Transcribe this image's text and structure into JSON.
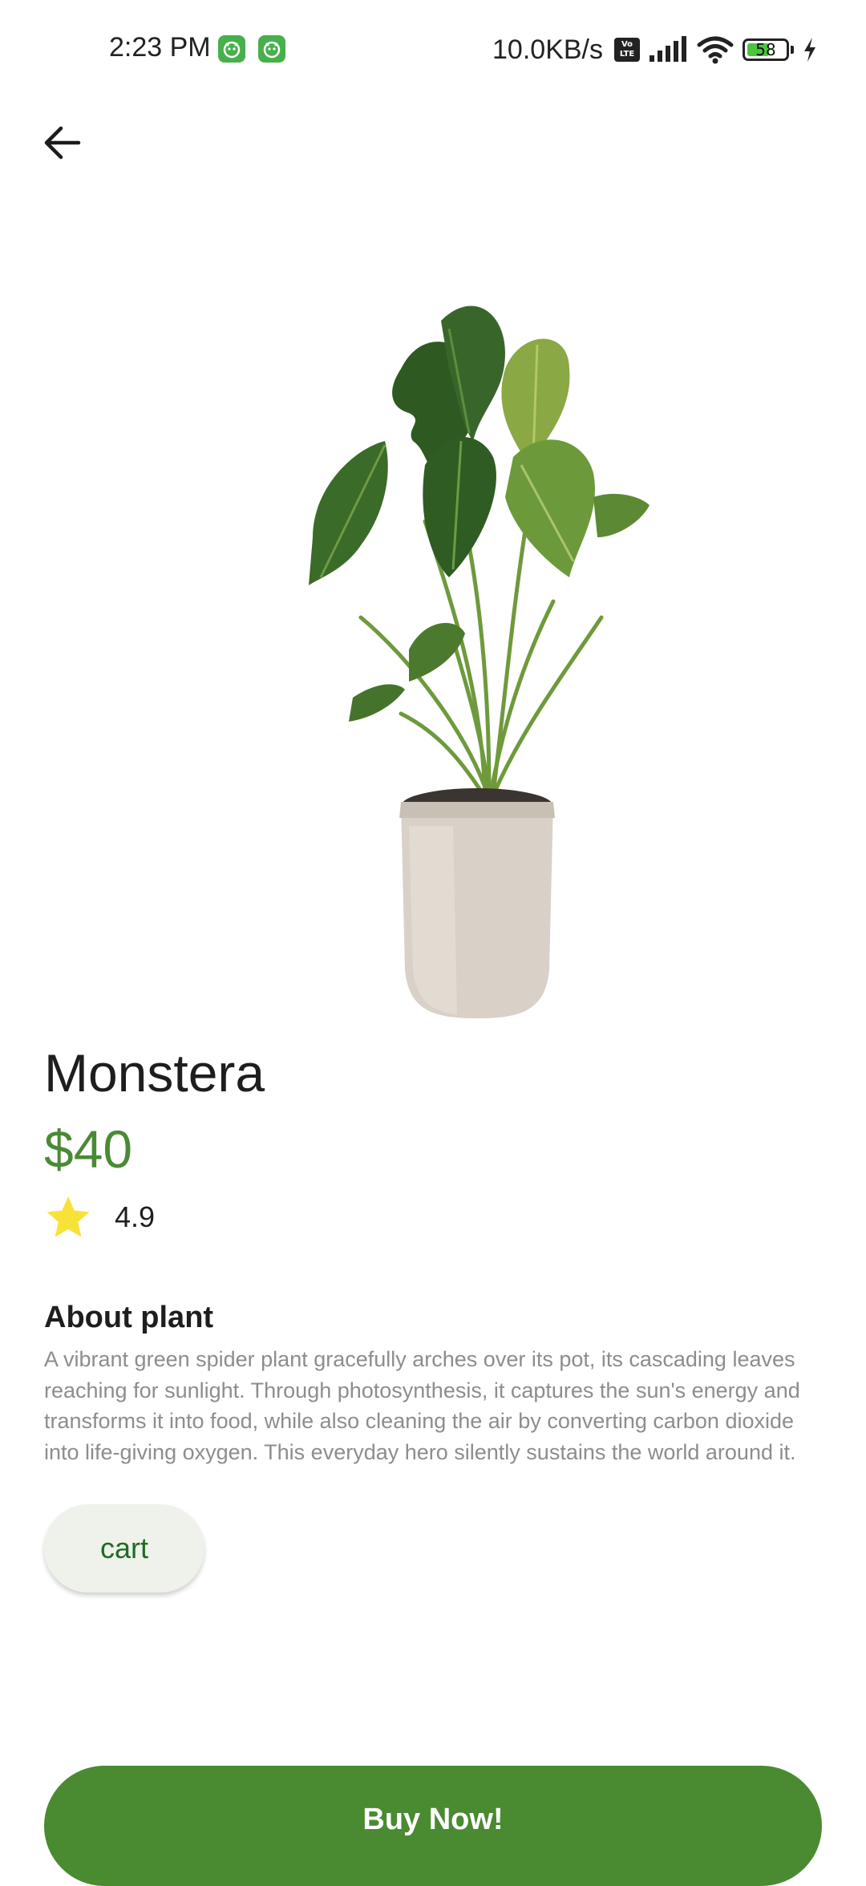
{
  "status_bar": {
    "time": "2:23 PM",
    "net_speed": "10.0KB/s",
    "volte_line1": "Vo",
    "volte_line2": "LTE",
    "battery_level": "58",
    "battery_fraction": 0.58
  },
  "icons": {
    "back": "arrow-left-icon",
    "rating": "star-icon"
  },
  "product": {
    "name": "Monstera",
    "price": "$40",
    "rating": "4.9",
    "about_title": "About plant",
    "about_text": "A vibrant green spider plant gracefully arches over its pot, its cascading leaves reaching for sunlight.  Through photosynthesis, it captures the sun's energy and transforms it into food, while also cleaning the air by converting carbon dioxide into life-giving oxygen. This everyday hero silently sustains the world around it."
  },
  "actions": {
    "cart_label": "cart",
    "buy_label": "Buy Now!"
  },
  "colors": {
    "accent_green": "#4a8a31",
    "price_green": "#4a8a35",
    "cart_text": "#1f6b24",
    "cart_bg": "#eef2ea",
    "star": "#f9e238"
  }
}
